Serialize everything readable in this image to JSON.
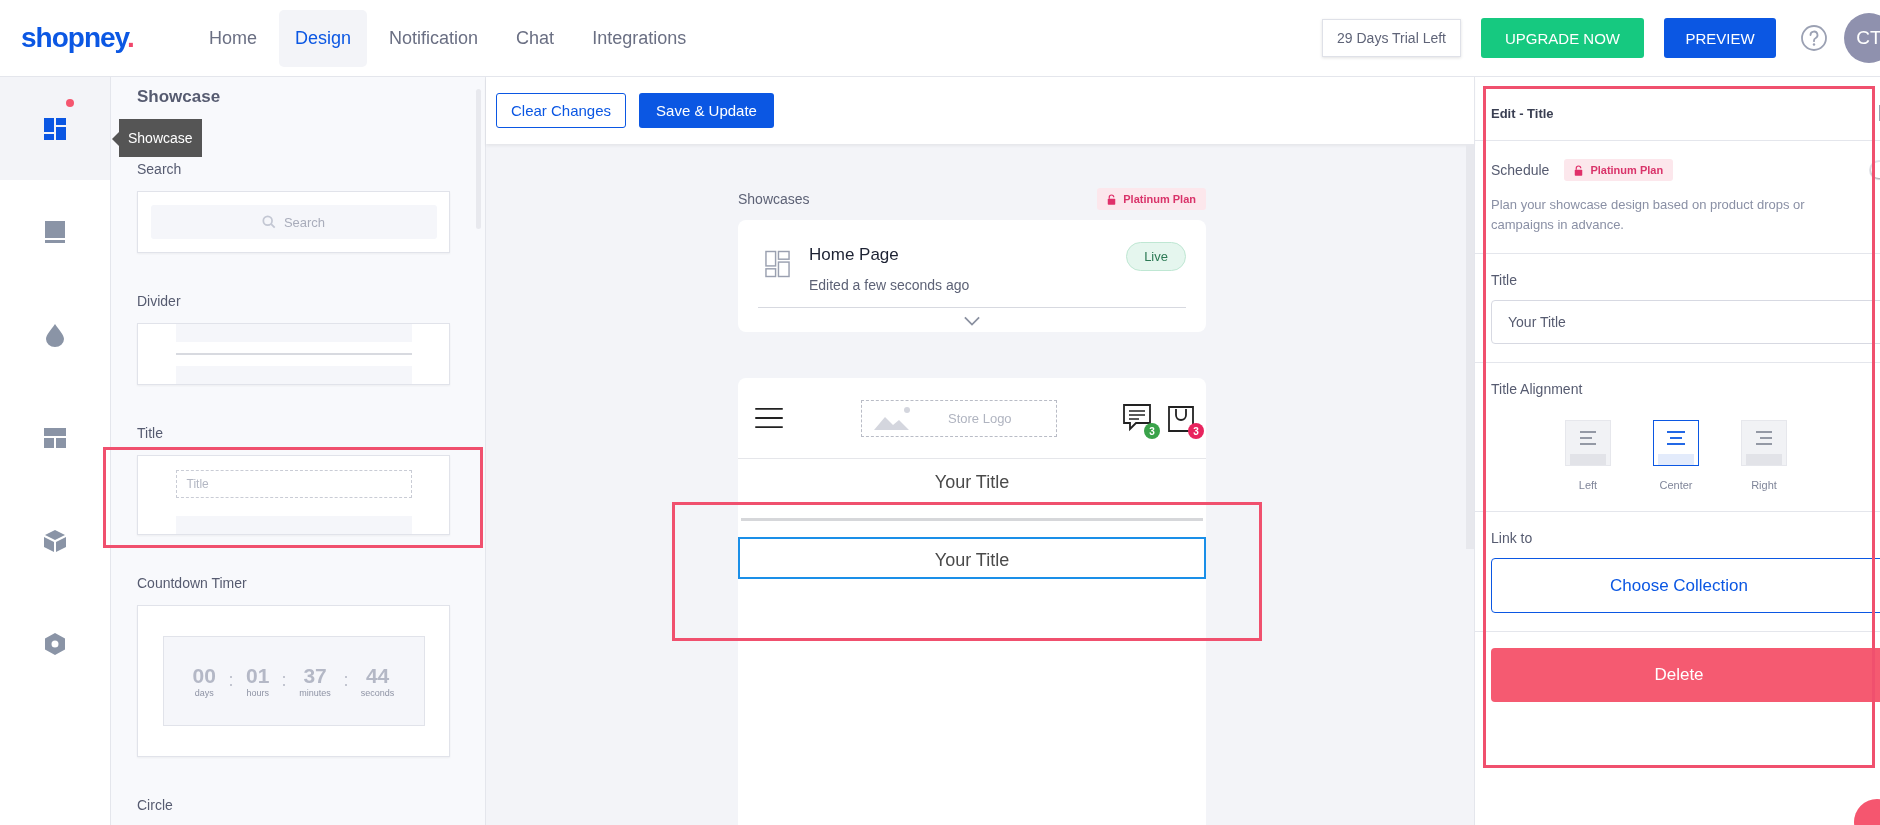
{
  "logo": {
    "text": "shopney",
    "mark": "."
  },
  "nav": [
    {
      "label": "Home",
      "selected": false
    },
    {
      "label": "Design",
      "selected": true
    },
    {
      "label": "Notification",
      "selected": false
    },
    {
      "label": "Chat",
      "selected": false
    },
    {
      "label": "Integrations",
      "selected": false
    }
  ],
  "trial": "29 Days Trial Left",
  "upgrade_button": "UPGRADE NOW",
  "preview_button": "PREVIEW",
  "avatar": "CT",
  "rail": [
    {
      "kind": "grid",
      "selected": true,
      "badge": true
    },
    {
      "kind": "book",
      "selected": false,
      "badge": false
    },
    {
      "kind": "drop",
      "selected": false,
      "badge": false
    },
    {
      "kind": "layout",
      "selected": false,
      "badge": false
    },
    {
      "kind": "cube",
      "selected": false,
      "badge": false
    },
    {
      "kind": "hexagon",
      "selected": false,
      "badge": false
    }
  ],
  "tooltip": "Showcase",
  "components": {
    "heading": "Showcase",
    "sections": [
      {
        "kind": "search",
        "label": "Search",
        "placeholder": "Search"
      },
      {
        "kind": "divider",
        "label": "Divider"
      },
      {
        "kind": "title",
        "label": "Title",
        "placeholder": "Title"
      },
      {
        "kind": "countdown",
        "label": "Countdown Timer",
        "units": [
          {
            "value": "00",
            "unit": "days"
          },
          {
            "value": "01",
            "unit": "hours"
          },
          {
            "value": "37",
            "unit": "minutes"
          },
          {
            "value": "44",
            "unit": "seconds"
          }
        ]
      },
      {
        "kind": "circle",
        "label": "Circle"
      }
    ]
  },
  "toolbar": {
    "clear_button": "Clear Changes",
    "save_button": "Save & Update"
  },
  "showcases": {
    "label": "Showcases",
    "plan": "Platinum Plan",
    "page": {
      "name": "Home Page",
      "edited": "Edited a few seconds ago",
      "status": "Live"
    }
  },
  "preview": {
    "logo": "Store Logo",
    "chat_count": "3",
    "bag_count": "3",
    "blocks": [
      {
        "kind": "title",
        "text": "Your Title",
        "selected": false
      },
      {
        "kind": "divider"
      },
      {
        "kind": "title",
        "text": "Your Title",
        "selected": true
      }
    ]
  },
  "editor": {
    "title": "Edit - Title",
    "schedule": {
      "label": "Schedule",
      "plan": "Platinum Plan",
      "on": false,
      "description": "Plan your showcase design based on product drops or campaigns in advance."
    },
    "title_label": "Title",
    "title_value": "Your Title",
    "alignment": {
      "label": "Title Alignment",
      "options": [
        {
          "kind": "left",
          "label": "Left",
          "selected": false
        },
        {
          "kind": "center",
          "label": "Center",
          "selected": true
        },
        {
          "kind": "right",
          "label": "Right",
          "selected": false
        }
      ]
    },
    "link_label": "Link to",
    "link_button": "Choose Collection",
    "delete_button": "Delete"
  }
}
